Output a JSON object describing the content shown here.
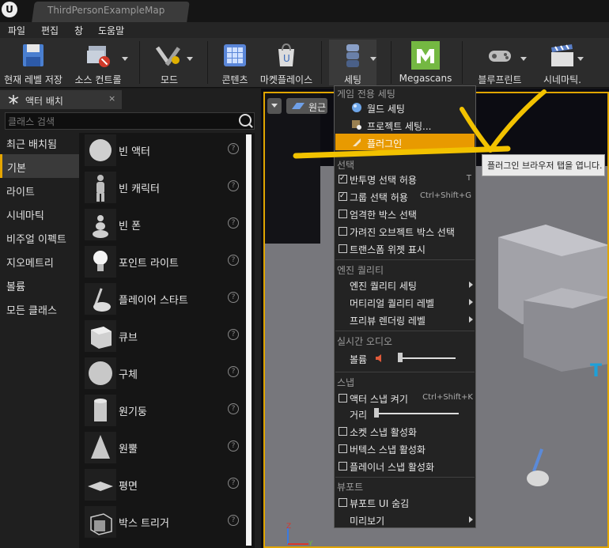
{
  "window": {
    "tab_title": "ThirdPersonExampleMap"
  },
  "menubar": [
    "파일",
    "편집",
    "창",
    "도움말"
  ],
  "toolbar": {
    "items": [
      {
        "label": "현재 레벨 저장",
        "icon": "save-icon"
      },
      {
        "label": "소스 컨트롤",
        "icon": "source-control-icon"
      },
      {
        "label": "모드",
        "icon": "modes-icon"
      },
      {
        "label": "콘텐츠",
        "icon": "content-icon"
      },
      {
        "label": "마켓플레이스",
        "icon": "marketplace-icon"
      },
      {
        "label": "세팅",
        "icon": "settings-icon"
      },
      {
        "label": "Megascans",
        "icon": "megascans-icon"
      },
      {
        "label": "블루프린트",
        "icon": "blueprint-icon"
      },
      {
        "label": "시네마틱.",
        "icon": "cinematics-icon"
      }
    ]
  },
  "panel": {
    "tab_label": "액터 배치",
    "close": "×",
    "search_placeholder": "클래스 검색",
    "categories": [
      "최근 배치됨",
      "기본",
      "라이트",
      "시네마틱",
      "비주얼 이펙트",
      "지오메트리",
      "볼륨",
      "모든 클래스"
    ],
    "active_category": "기본",
    "items": [
      "빈 액터",
      "빈 캐릭터",
      "빈 폰",
      "포인트 라이트",
      "플레이어 스타트",
      "큐브",
      "구체",
      "원기둥",
      "원뿔",
      "평면",
      "박스 트리거"
    ]
  },
  "viewport": {
    "perspective_label": "원근"
  },
  "dropdown": {
    "header_game": "게임 전용 세팅",
    "world_settings": "월드 세팅",
    "project_settings": "프로젝트 세팅...",
    "plugins": "플러그인",
    "header_selection": "선택",
    "translucent_select": "반투명 선택 허용",
    "translucent_shortcut": "T",
    "group_select": "그룹 선택 허용",
    "group_shortcut": "Ctrl+Shift+G",
    "strict_box": "엄격한 박스 선택",
    "occluded_box": "가려진 오브젝트 박스 선택",
    "transform_widget": "트랜스폼 위젯 표시",
    "header_engine": "엔진 퀄리티",
    "engine_quality": "엔진 퀄리티 세팅",
    "material_quality": "머티리얼 퀄리티 레벨",
    "preview_level": "프리뷰 렌더링 레벨",
    "header_audio": "실시간 오디오",
    "volume": "볼륨",
    "header_snap": "스냅",
    "actor_snap": "액터 스냅 켜기",
    "actor_snap_shortcut": "Ctrl+Shift+K",
    "distance": "거리",
    "socket_snap": "소켓 스냅 활성화",
    "vertex_snap": "버텍스 스냅 활성화",
    "planar_snap": "플레이너 스냅 활성화",
    "header_viewport": "뷰포트",
    "hide_ui": "뷰포트 UI 숨김",
    "preview": "미리보기",
    "tooltip": "플러그인 브라우저 탭을 엽니다."
  },
  "colors": {
    "accent": "#e89a00",
    "annotation": "#f2c200",
    "panel_bg": "#1f1f1f"
  }
}
